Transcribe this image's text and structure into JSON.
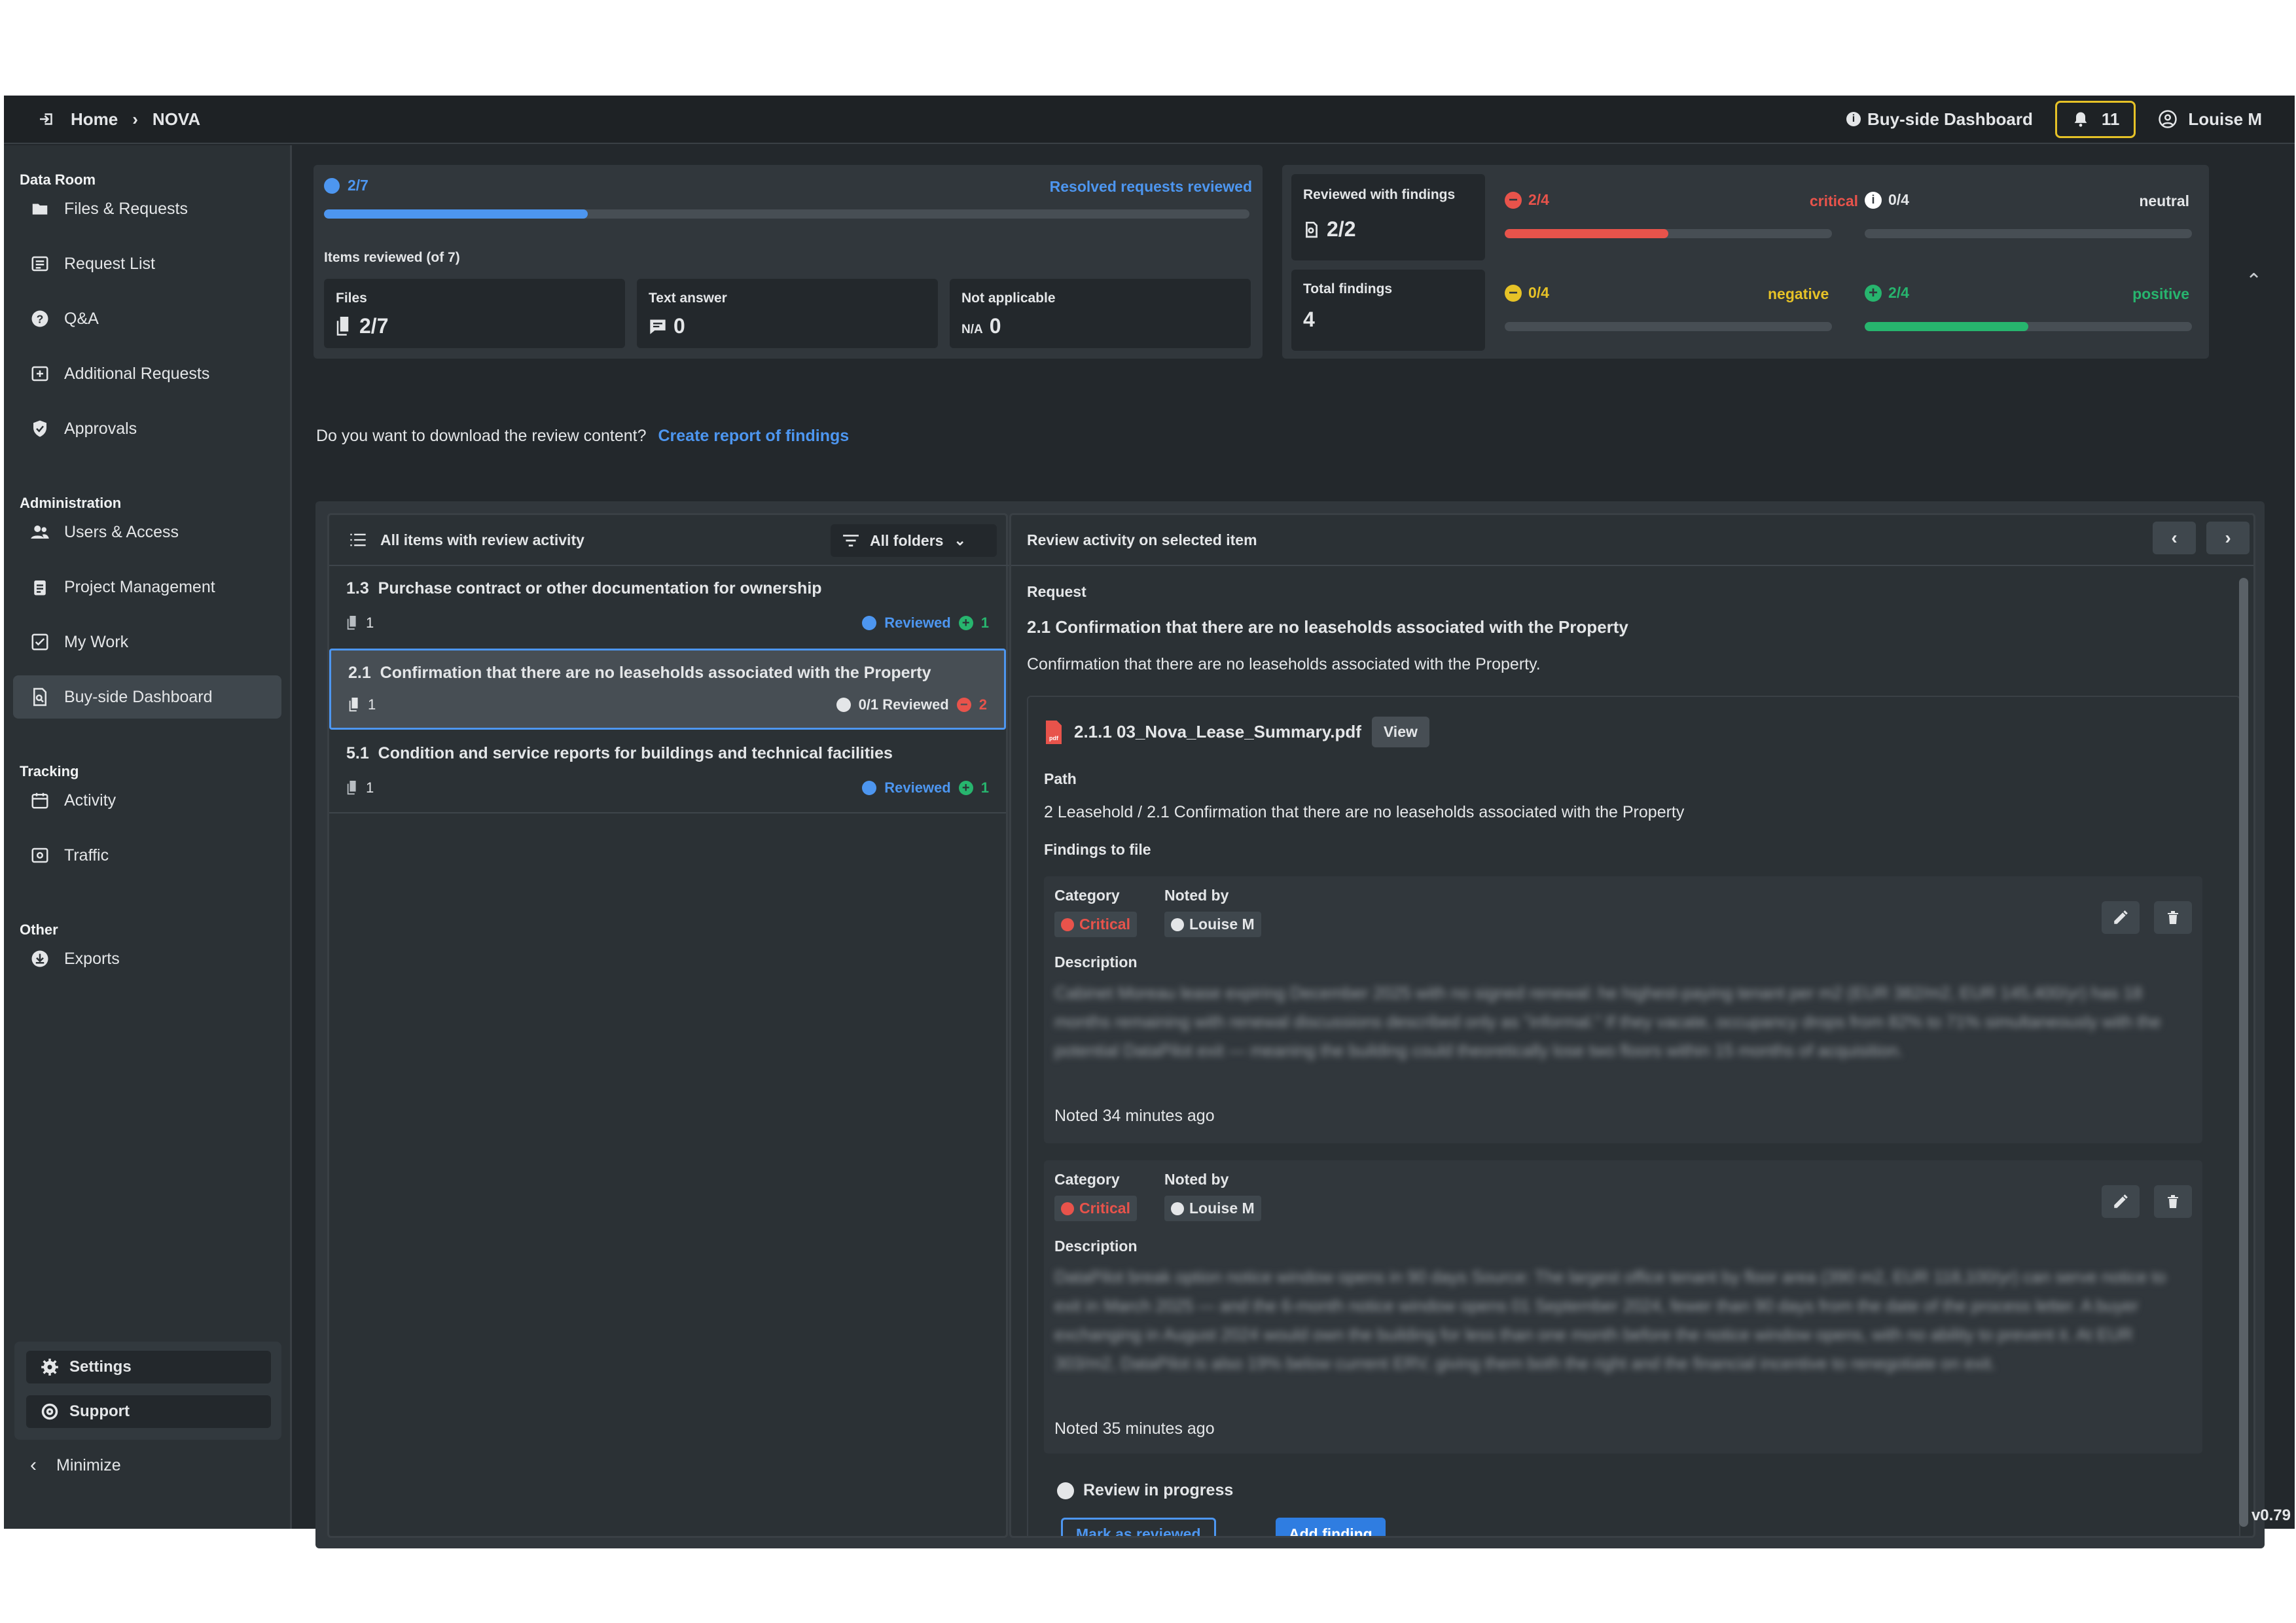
{
  "topbar": {
    "home": "Home",
    "project": "NOVA",
    "dashboard_link": "Buy-side Dashboard",
    "notif_count": "11",
    "user": "Louise M"
  },
  "sidebar": {
    "data_room": "Data Room",
    "files_requests": "Files & Requests",
    "request_list": "Request List",
    "qa": "Q&A",
    "additional_requests": "Additional Requests",
    "approvals": "Approvals",
    "administration": "Administration",
    "users_access": "Users & Access",
    "project_management": "Project Management",
    "my_work": "My Work",
    "buyside_dashboard": "Buy-side Dashboard",
    "tracking": "Tracking",
    "activity": "Activity",
    "traffic": "Traffic",
    "other": "Other",
    "exports": "Exports",
    "settings": "Settings",
    "support": "Support",
    "minimize": "Minimize"
  },
  "summary": {
    "progress_label": "2/7",
    "progress_fraction": 0.285,
    "resolved_link": "Resolved requests reviewed",
    "items_reviewed": "Items reviewed (of 7)",
    "files_label": "Files",
    "files_value": "2/7",
    "text_label": "Text answer",
    "text_value": "0",
    "na_label": "Not applicable",
    "na_prefix": "N/A",
    "na_value": "0"
  },
  "findings_stats": {
    "reviewed_with_findings_label": "Reviewed with findings",
    "reviewed_with_findings_value": "2/2",
    "total_findings_label": "Total findings",
    "total_findings_value": "4",
    "critical_count": "2/4",
    "critical_label": "critical",
    "critical_fraction": 0.5,
    "neutral_count": "0/4",
    "neutral_label": "neutral",
    "neutral_fraction": 0,
    "negative_count": "0/4",
    "negative_label": "negative",
    "negative_fraction": 0,
    "positive_count": "2/4",
    "positive_label": "positive",
    "positive_fraction": 0.5,
    "colors": {
      "critical": "#e8534b",
      "negative": "#e6c227",
      "positive": "#27b56e",
      "neutral": "#ffffff"
    }
  },
  "download": {
    "question": "Do you want to download the review content?",
    "link": "Create report of findings"
  },
  "list": {
    "header": "All items with review activity",
    "filter": "All folders",
    "items": [
      {
        "num": "1.3",
        "title": "Purchase contract or other documentation for ownership",
        "files": "1",
        "status": "Reviewed",
        "count": "1"
      },
      {
        "num": "2.1",
        "title": "Confirmation that there are no leaseholds associated with the Property",
        "files": "1",
        "status": "0/1 Reviewed",
        "count": "2"
      },
      {
        "num": "5.1",
        "title": "Condition and service reports for buildings and technical facilities",
        "files": "1",
        "status": "Reviewed",
        "count": "1"
      }
    ]
  },
  "detail": {
    "header": "Review activity on selected item",
    "request_label": "Request",
    "request_title": "2.1 Confirmation that there are no leaseholds associated with the Property",
    "request_text": "Confirmation that there are no leaseholds associated with the Property.",
    "file_name": "2.1.1 03_Nova_Lease_Summary.pdf",
    "view_button": "View",
    "path_label": "Path",
    "path_value": "2 Leasehold / 2.1 Confirmation that there are no leaseholds associated with the Property",
    "findings_label": "Findings to file",
    "findings": [
      {
        "category_label": "Category",
        "category": "Critical",
        "noted_by_label": "Noted by",
        "noted_by": "Louise M",
        "description_label": "Description",
        "description": "Cabinet Moreau lease expiring December 2025 with no signed renewal: he highest-paying tenant per m2 (EUR 382/m2, EUR 145,400/yr) has 18 months remaining with renewal discussions described only as \"informal.\" If they vacate, occupancy drops from 82% to 71% simultaneously with the potential DataPilot exit — meaning the building could theoretically lose two floors within 15 months of acquisition.",
        "noted": "Noted 34 minutes ago"
      },
      {
        "category_label": "Category",
        "category": "Critical",
        "noted_by_label": "Noted by",
        "noted_by": "Louise M",
        "description_label": "Description",
        "description": "DataPilot break option notice window opens in 90 days Source: The largest office tenant by floor area (390 m2, EUR 118,100/yr) can serve notice to exit in March 2025 — and the 6-month notice window opens 01 September 2024, fewer than 90 days from the date of the process letter. A buyer exchanging in August 2024 would own the building for less than one month before the notice window opens, with no ability to prevent it. At EUR 303/m2, DataPilot is also 19% below current ERV, giving them both the right and the financial incentive to renegotiate on exit.",
        "noted": "Noted 35 minutes ago"
      }
    ],
    "review_status": "Review in progress",
    "mark_reviewed": "Mark as reviewed",
    "add_finding": "Add finding"
  },
  "version": "v0.79"
}
